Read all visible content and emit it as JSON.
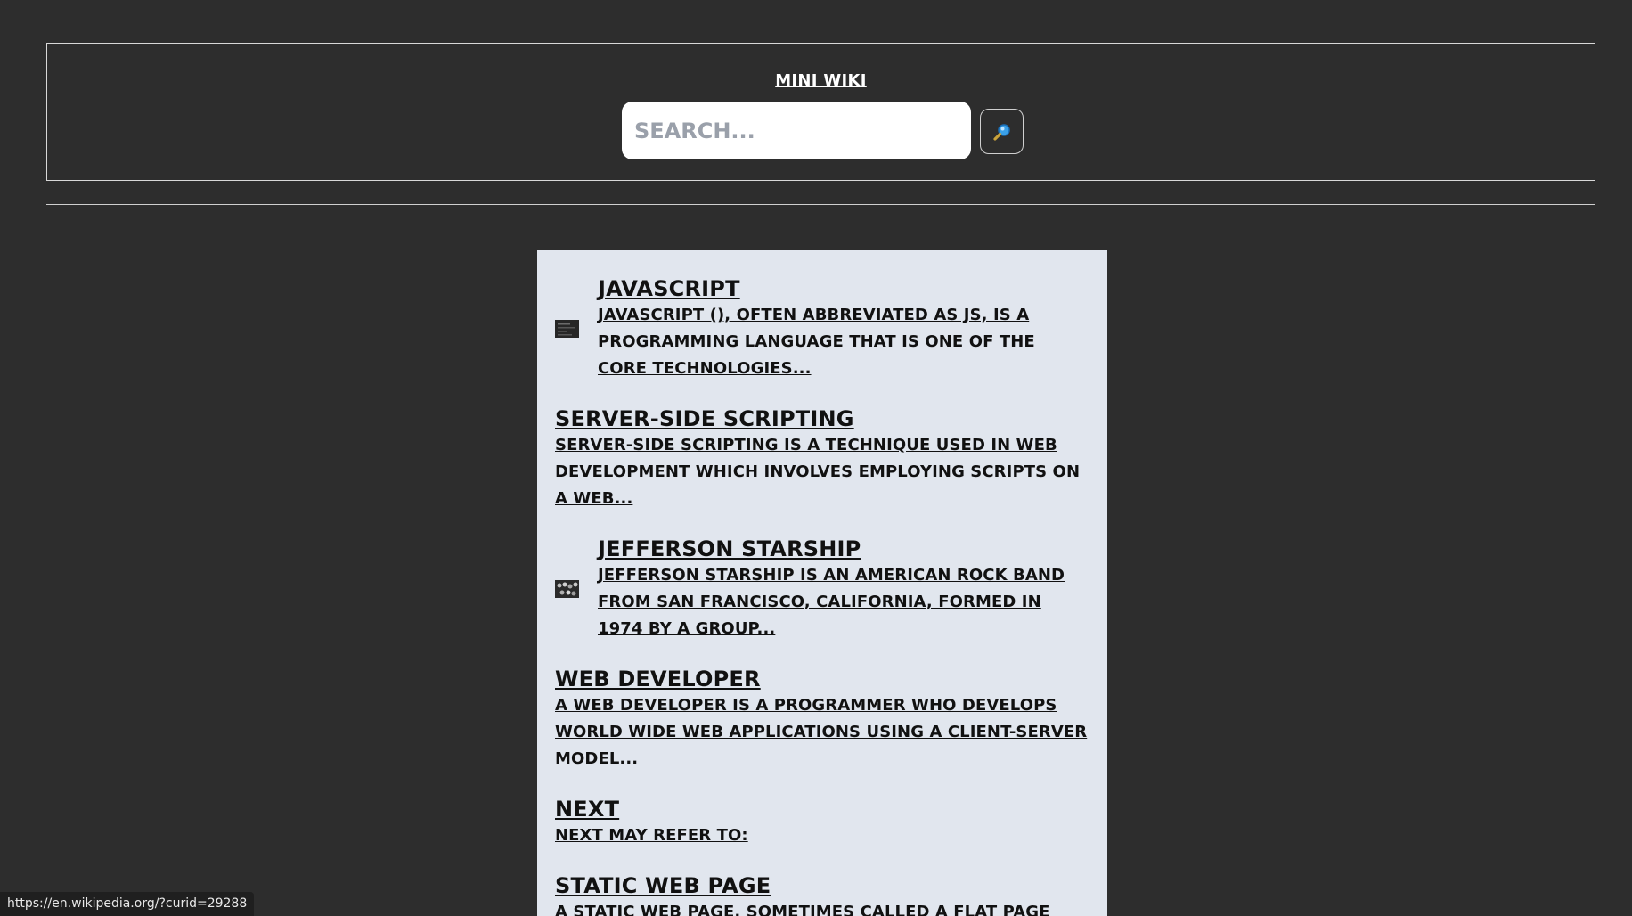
{
  "header": {
    "title": "MINI WIKI",
    "search_placeholder": "SEARCH...",
    "search_icon": "magnifier-icon"
  },
  "results": [
    {
      "title": "JAVASCRIPT",
      "snippet": "JAVASCRIPT (), OFTEN ABBREVIATED AS JS, IS A PROGRAMMING LANGUAGE THAT IS ONE OF THE CORE TECHNOLOGIES...",
      "has_thumbnail": true
    },
    {
      "title": "SERVER-SIDE SCRIPTING",
      "snippet": "SERVER-SIDE SCRIPTING IS A TECHNIQUE USED IN WEB DEVELOPMENT WHICH INVOLVES EMPLOYING SCRIPTS ON A WEB...",
      "has_thumbnail": false
    },
    {
      "title": "JEFFERSON STARSHIP",
      "snippet": "JEFFERSON STARSHIP IS AN AMERICAN ROCK BAND FROM SAN FRANCISCO, CALIFORNIA, FORMED IN 1974 BY A GROUP...",
      "has_thumbnail": true
    },
    {
      "title": "WEB DEVELOPER",
      "snippet": "A WEB DEVELOPER IS A PROGRAMMER WHO DEVELOPS WORLD WIDE WEB APPLICATIONS USING A CLIENT-SERVER MODEL...",
      "has_thumbnail": false
    },
    {
      "title": "NEXT",
      "snippet": "NEXT MAY REFER TO:",
      "has_thumbnail": false
    },
    {
      "title": "STATIC WEB PAGE",
      "snippet": "A STATIC WEB PAGE, SOMETIMES CALLED A FLAT PAGE",
      "has_thumbnail": false
    }
  ],
  "status_bar": {
    "url": "https://en.wikipedia.org/?curid=29288"
  },
  "colors": {
    "background": "#2d2d2d",
    "results_panel": "#e1e6ee",
    "text_dark": "#111111",
    "text_light": "#ffffff"
  }
}
